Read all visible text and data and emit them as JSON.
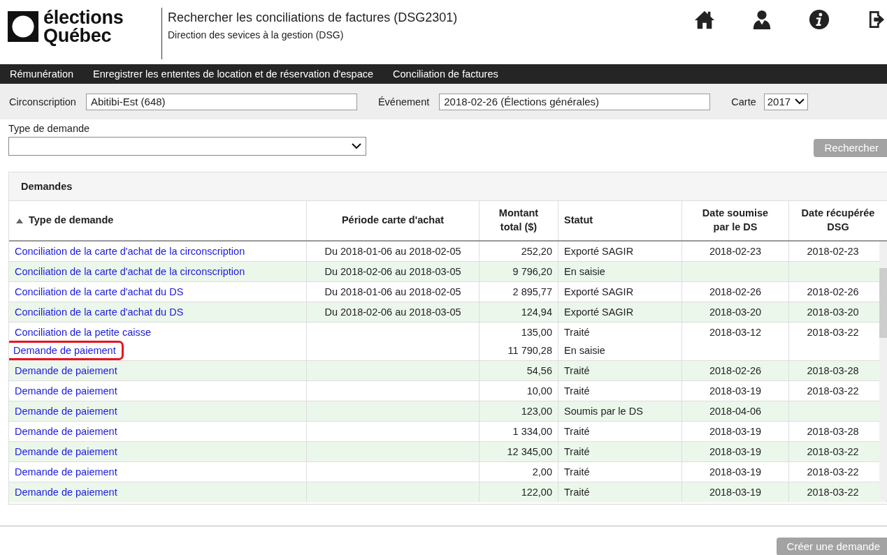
{
  "logo": {
    "line1": "élections",
    "line2": "Québec"
  },
  "header": {
    "title": "Rechercher les conciliations de factures (DSG2301)",
    "subtitle": "Direction des sevices à la gestion (DSG)",
    "icons": [
      {
        "kind": "home"
      },
      {
        "kind": "user"
      },
      {
        "kind": "info"
      },
      {
        "kind": "logout"
      }
    ]
  },
  "nav": [
    "Rémunération",
    "Enregistrer les ententes de location et de réservation d'espace",
    "Conciliation de factures"
  ],
  "filters": {
    "circonscription": {
      "label": "Circonscription",
      "value": "Abitibi-Est (648)"
    },
    "evenement": {
      "label": "Événement",
      "value": "2018-02-26 (Élections générales)"
    },
    "carte": {
      "label": "Carte",
      "value": "2017"
    }
  },
  "type_demande": {
    "label": "Type de demande"
  },
  "search_button": "Rechercher",
  "panel": {
    "title": "Demandes",
    "columns": [
      {
        "label": "Type de demande",
        "sorted": true
      },
      {
        "label": "Période carte d'achat",
        "sorted": false
      },
      {
        "label": "Montant total ($)",
        "sorted": false
      },
      {
        "label": "Statut",
        "sorted": false
      },
      {
        "label": "Date soumise par le DS",
        "sorted": false
      },
      {
        "label": "Date récupérée DSG",
        "sorted": false
      }
    ],
    "rows": [
      {
        "entries": [
          {
            "type": "Conciliation de la carte d'achat de la circonscription",
            "period": "Du 2018-01-06 au 2018-02-05",
            "amount": "252,20",
            "status": "Exporté SAGIR",
            "submitted": "2018-02-23",
            "retrieved": "2018-02-23"
          }
        ]
      },
      {
        "entries": [
          {
            "type": "Conciliation de la carte d'achat de la circonscription",
            "period": "Du 2018-02-06 au 2018-03-05",
            "amount": "9 796,20",
            "status": "En saisie"
          }
        ]
      },
      {
        "entries": [
          {
            "type": "Conciliation de la carte d'achat du DS",
            "period": "Du 2018-01-06 au 2018-02-05",
            "amount": "2 895,77",
            "status": "Exporté SAGIR",
            "submitted": "2018-02-26",
            "retrieved": "2018-02-26"
          }
        ]
      },
      {
        "entries": [
          {
            "type": "Conciliation de la carte d'achat du DS",
            "period": "Du 2018-02-06 au 2018-03-05",
            "amount": "124,94",
            "status": "Exporté SAGIR",
            "submitted": "2018-03-20",
            "retrieved": "2018-03-20"
          }
        ]
      },
      {
        "entries": [
          {
            "type": "Conciliation de la petite caisse",
            "amount": "135,00",
            "status": "Traité",
            "submitted": "2018-03-12",
            "retrieved": "2018-03-22"
          },
          {
            "type": "Demande de paiement",
            "amount": "11 790,28",
            "status": "En saisie",
            "highlighted": true
          }
        ]
      },
      {
        "entries": [
          {
            "type": "Demande de paiement",
            "amount": "54,56",
            "status": "Traité",
            "submitted": "2018-02-26",
            "retrieved": "2018-03-28"
          }
        ]
      },
      {
        "entries": [
          {
            "type": "Demande de paiement",
            "amount": "10,00",
            "status": "Traité",
            "submitted": "2018-03-19",
            "retrieved": "2018-03-22"
          }
        ]
      },
      {
        "entries": [
          {
            "type": "Demande de paiement",
            "amount": "123,00",
            "status": "Soumis par le DS",
            "submitted": "2018-04-06"
          }
        ]
      },
      {
        "entries": [
          {
            "type": "Demande de paiement",
            "amount": "1 334,00",
            "status": "Traité",
            "submitted": "2018-03-19",
            "retrieved": "2018-03-28"
          }
        ]
      },
      {
        "entries": [
          {
            "type": "Demande de paiement",
            "amount": "12 345,00",
            "status": "Traité",
            "submitted": "2018-03-19",
            "retrieved": "2018-03-22"
          }
        ]
      },
      {
        "entries": [
          {
            "type": "Demande de paiement",
            "amount": "2,00",
            "status": "Traité",
            "submitted": "2018-03-19",
            "retrieved": "2018-03-22"
          }
        ]
      },
      {
        "entries": [
          {
            "type": "Demande de paiement",
            "amount": "122,00",
            "status": "Traité",
            "submitted": "2018-03-19",
            "retrieved": "2018-03-22"
          }
        ]
      }
    ]
  },
  "create_button": "Créer une demande"
}
